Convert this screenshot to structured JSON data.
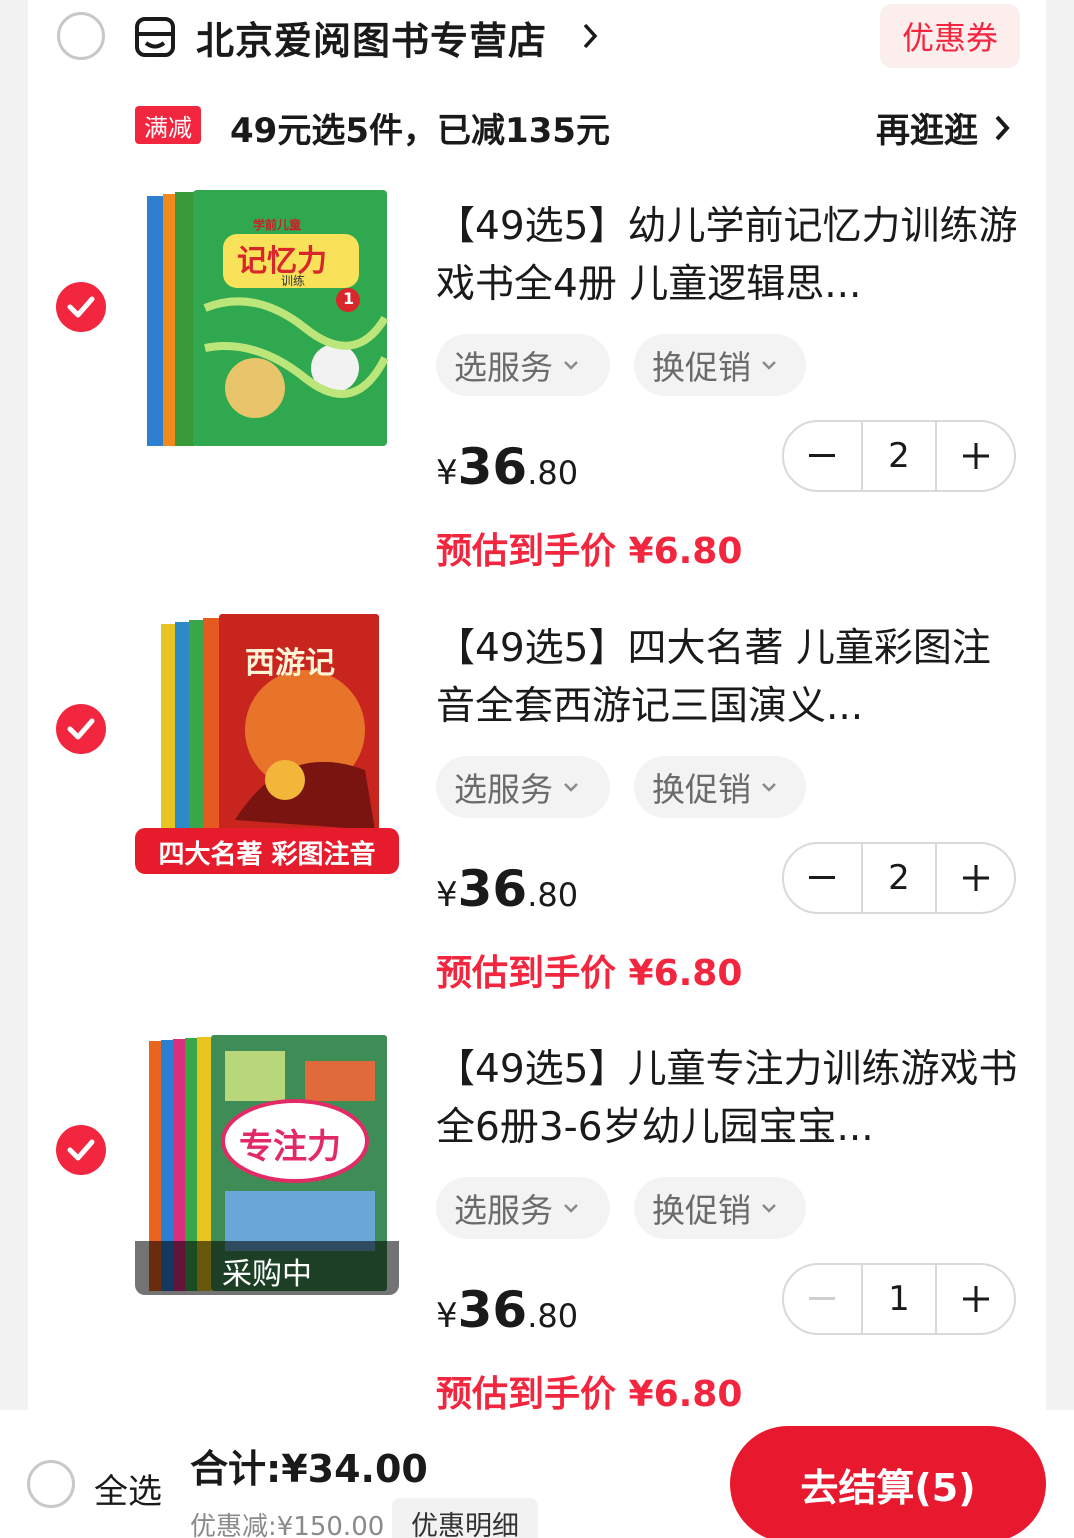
{
  "store": {
    "name": "北京爱阅图书专营店",
    "coupon_label": "优惠券"
  },
  "promo": {
    "tag": "满减",
    "text": "49元选5件，已减135元",
    "more_label": "再逛逛"
  },
  "items": [
    {
      "title": "【49选5】幼儿学前记忆力训练游戏书全4册 儿童逻辑思...",
      "service_label": "选服务",
      "promo_label": "换促销",
      "quantity": "2",
      "price_symbol": "¥",
      "price_int": "36",
      "price_dec": ".80",
      "estimate": "预估到手价 ¥6.80",
      "cover_title": "记忆力",
      "cover_subtitle": "学前儿童",
      "cover_sub2": "训练",
      "cover_badge": "1"
    },
    {
      "title": "【49选5】四大名著 儿童彩图注音全套西游记三国演义...",
      "service_label": "选服务",
      "promo_label": "换促销",
      "quantity": "2",
      "price_symbol": "¥",
      "price_int": "36",
      "price_dec": ".80",
      "estimate": "预估到手价 ¥6.80",
      "cover_title": "西游记",
      "cover_banner": "四大名著 彩图注音"
    },
    {
      "title": "【49选5】儿童专注力训练游戏书全6册3-6岁幼儿园宝宝...",
      "service_label": "选服务",
      "promo_label": "换促销",
      "quantity": "1",
      "price_symbol": "¥",
      "price_int": "36",
      "price_dec": ".80",
      "estimate": "预估到手价 ¥6.80",
      "cover_title": "专注力",
      "cover_overlay": "采购中"
    }
  ],
  "bottom": {
    "select_all_label": "全选",
    "total": "合计:¥34.00",
    "discount": "优惠减:¥150.00",
    "detail_label": "优惠明细",
    "checkout_label": "去结算(5)"
  },
  "colors": {
    "accent": "#f2273f",
    "checkout": "#e8192f",
    "pill_bg": "#f3f3f3"
  }
}
